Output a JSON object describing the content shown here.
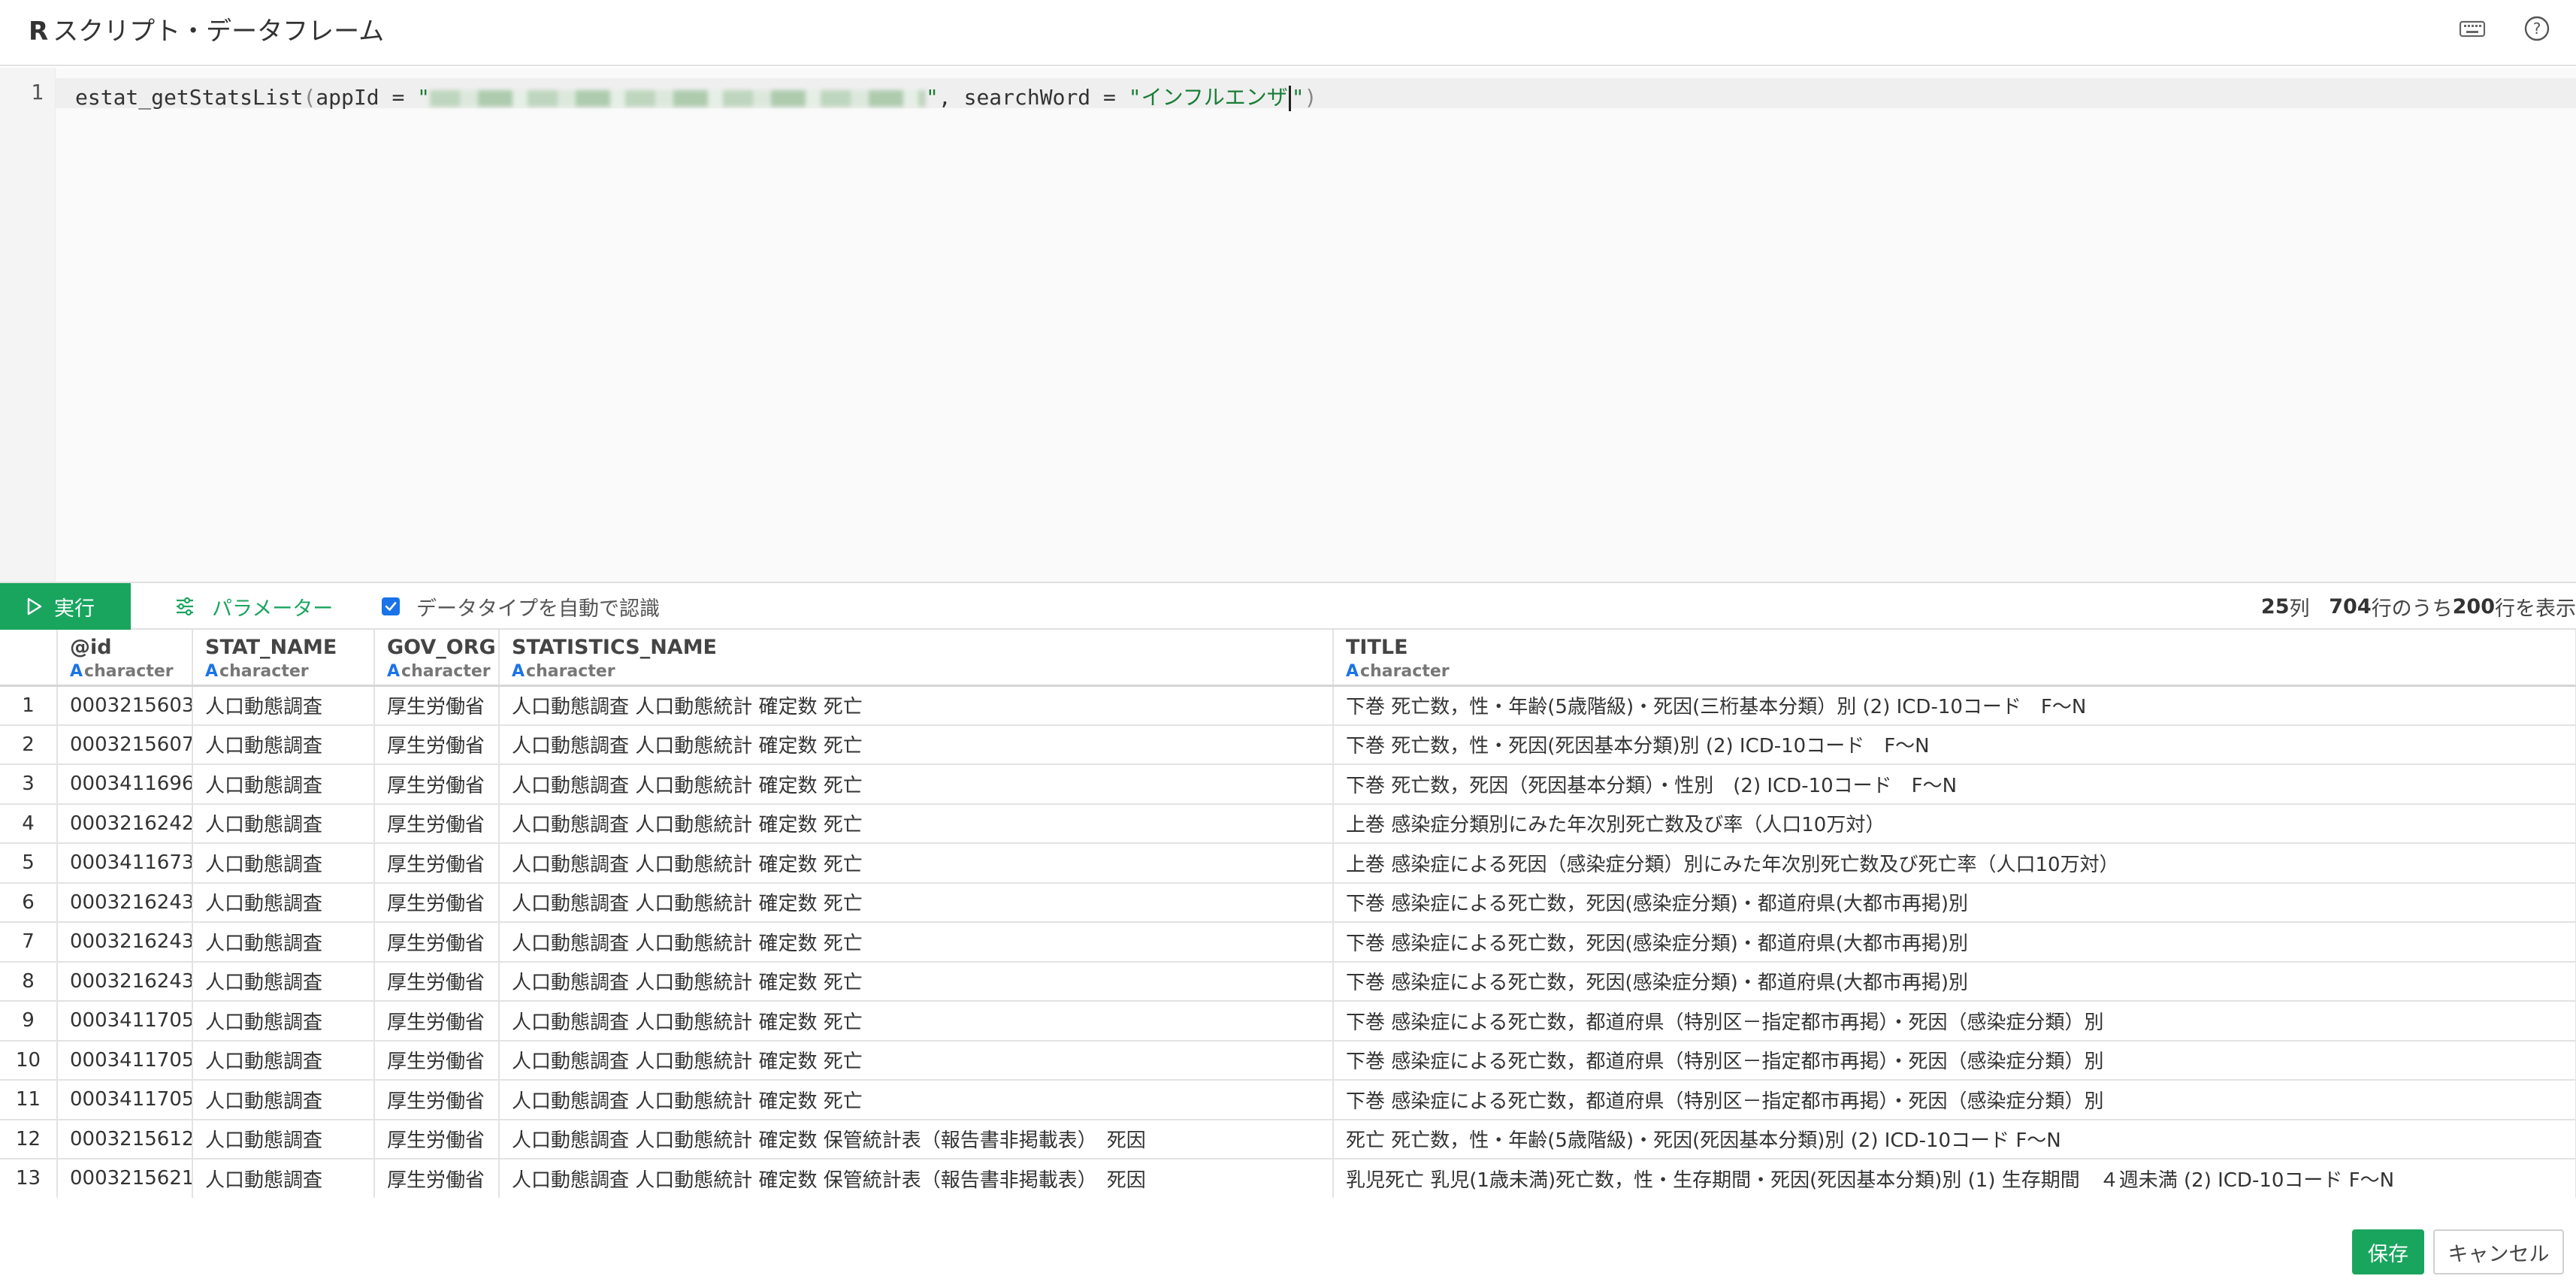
{
  "header": {
    "title_r": "R",
    "title": "スクリプト・データフレーム",
    "keyboard_icon": "keyboard-icon",
    "help_icon": "help-icon"
  },
  "editor": {
    "line_number": "1",
    "code": {
      "fn": "estat_getStatsList",
      "open_paren": "(",
      "arg1": "appId = ",
      "q_open": "\"",
      "q_close": "\"",
      "sep": ", searchWord = ",
      "search_value": "\"インフルエンザ",
      "search_end": "\"",
      "close_paren": ")"
    }
  },
  "toolbar": {
    "run_label": "実行",
    "param_label": "パラメーター",
    "auto_detect_label": "データタイプを自動で認識",
    "auto_detect_checked": true,
    "summary": {
      "cols": "25",
      "cols_unit": " 列",
      "total": "704",
      "total_unit": "行のうち",
      "shown": "200",
      "shown_unit": "行を表示"
    }
  },
  "table": {
    "columns": [
      {
        "name": "@id",
        "type": "character"
      },
      {
        "name": "STAT_NAME",
        "type": "character"
      },
      {
        "name": "GOV_ORG",
        "type": "character"
      },
      {
        "name": "STATISTICS_NAME",
        "type": "character"
      },
      {
        "name": "TITLE",
        "type": "character"
      }
    ],
    "type_letter": "A",
    "rows": [
      [
        "1",
        "0003215603",
        "人口動態調査",
        "厚生労働省",
        "人口動態調査 人口動態統計 確定数 死亡",
        "下巻 死亡数，性・年齢(5歳階級)・死因(三桁基本分類）別 (2) ICD-10コード　F〜N"
      ],
      [
        "2",
        "0003215607",
        "人口動態調査",
        "厚生労働省",
        "人口動態調査 人口動態統計 確定数 死亡",
        "下巻 死亡数，性・死因(死因基本分類)別 (2) ICD-10コード　F〜N"
      ],
      [
        "3",
        "0003411696",
        "人口動態調査",
        "厚生労働省",
        "人口動態調査 人口動態統計 確定数 死亡",
        "下巻 死亡数，死因（死因基本分類）・性別　(2) ICD-10コード　F〜N"
      ],
      [
        "4",
        "0003216242",
        "人口動態調査",
        "厚生労働省",
        "人口動態調査 人口動態統計 確定数 死亡",
        "上巻 感染症分類別にみた年次別死亡数及び率（人口10万対）"
      ],
      [
        "5",
        "0003411673",
        "人口動態調査",
        "厚生労働省",
        "人口動態調査 人口動態統計 確定数 死亡",
        "上巻 感染症による死因（感染症分類）別にみた年次別死亡数及び死亡率（人口10万対）"
      ],
      [
        "6",
        "0003216243",
        "人口動態調査",
        "厚生労働省",
        "人口動態調査 人口動態統計 確定数 死亡",
        "下巻 感染症による死亡数，死因(感染症分類)・都道府県(大都市再掲)別"
      ],
      [
        "7",
        "0003216243",
        "人口動態調査",
        "厚生労働省",
        "人口動態調査 人口動態統計 確定数 死亡",
        "下巻 感染症による死亡数，死因(感染症分類)・都道府県(大都市再掲)別"
      ],
      [
        "8",
        "0003216243",
        "人口動態調査",
        "厚生労働省",
        "人口動態調査 人口動態統計 確定数 死亡",
        "下巻 感染症による死亡数，死因(感染症分類)・都道府県(大都市再掲)別"
      ],
      [
        "9",
        "0003411705",
        "人口動態調査",
        "厚生労働省",
        "人口動態調査 人口動態統計 確定数 死亡",
        "下巻 感染症による死亡数，都道府県（特別区－指定都市再掲）・死因（感染症分類）別"
      ],
      [
        "10",
        "0003411705",
        "人口動態調査",
        "厚生労働省",
        "人口動態調査 人口動態統計 確定数 死亡",
        "下巻 感染症による死亡数，都道府県（特別区－指定都市再掲）・死因（感染症分類）別"
      ],
      [
        "11",
        "0003411705",
        "人口動態調査",
        "厚生労働省",
        "人口動態調査 人口動態統計 確定数 死亡",
        "下巻 感染症による死亡数，都道府県（特別区－指定都市再掲）・死因（感染症分類）別"
      ],
      [
        "12",
        "0003215612",
        "人口動態調査",
        "厚生労働省",
        "人口動態調査 人口動態統計 確定数 保管統計表（報告書非掲載表）　死因",
        "死亡 死亡数，性・年齢(5歳階級)・死因(死因基本分類)別 (2) ICD-10コード F〜N"
      ],
      [
        "13",
        "0003215621",
        "人口動態調査",
        "厚生労働省",
        "人口動態調査 人口動態統計 確定数 保管統計表（報告書非掲載表）　死因",
        "乳児死亡 乳児(1歳未満)死亡数，性・生存期間・死因(死因基本分類)別 (1) 生存期間　４週未満 (2) ICD-10コード F〜N"
      ]
    ]
  },
  "footer": {
    "save_label": "保存",
    "cancel_label": "キャンセル"
  },
  "colors": {
    "accent_green": "#1aa55f",
    "type_blue": "#1a73e8",
    "string_green": "#1a7f37"
  }
}
